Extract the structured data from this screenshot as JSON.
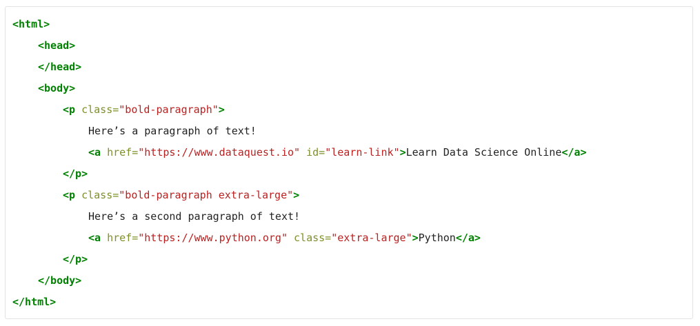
{
  "code": {
    "html_open": "<html>",
    "head_open": "<head>",
    "head_close": "</head>",
    "body_open": "<body>",
    "p1": {
      "tag_open": "<p",
      "attr_class": "class=",
      "class_value": "\"bold-paragraph\"",
      "tag_end": ">",
      "text": "Here’s a paragraph of text!",
      "link": {
        "tag_open": "<a",
        "attr_href": "href=",
        "href_value": "\"https://www.dataquest.io\"",
        "attr_id": "id=",
        "id_value": "\"learn-link\"",
        "tag_end": ">",
        "text": "Learn Data Science Online",
        "tag_close": "</a>"
      },
      "tag_close": "</p>"
    },
    "p2": {
      "tag_open": "<p",
      "attr_class": "class=",
      "class_value": "\"bold-paragraph extra-large\"",
      "tag_end": ">",
      "text": "Here’s a second paragraph of text!",
      "link": {
        "tag_open": "<a",
        "attr_href": "href=",
        "href_value": "\"https://www.python.org\"",
        "attr_class": "class=",
        "class_value": "\"extra-large\"",
        "tag_end": ">",
        "text": "Python",
        "tag_close": "</a>"
      },
      "tag_close": "</p>"
    },
    "body_close": "</body>",
    "html_close": "</html>"
  },
  "colors": {
    "tag": "#008000",
    "attr_name": "#7d9029",
    "attr_value": "#ba2121",
    "text": "#222222",
    "border": "#e2e2e2"
  }
}
